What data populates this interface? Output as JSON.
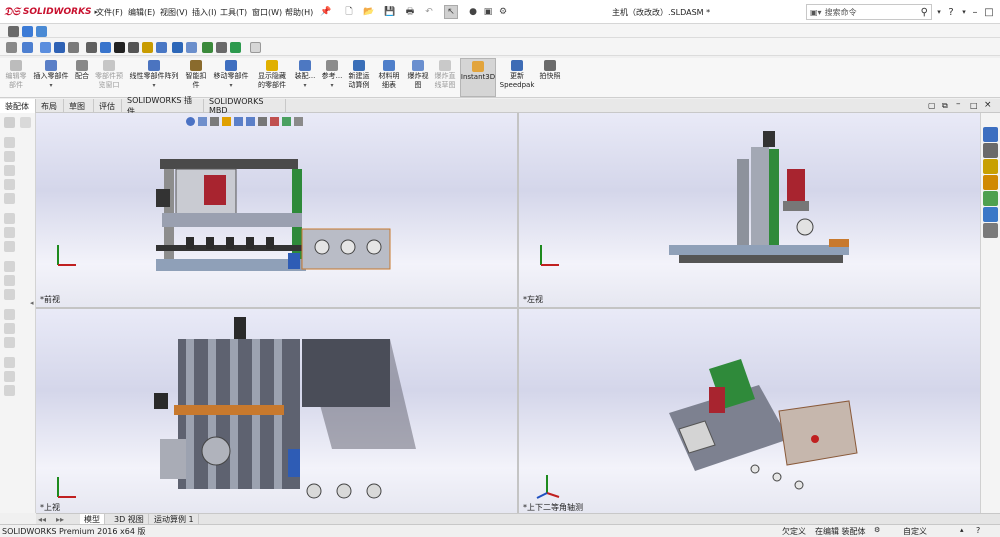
{
  "app": {
    "logo_text": "SOLIDWORKS",
    "document_title": "主机（改改改）.SLDASM *",
    "search_placeholder": "搜索命令"
  },
  "menu": [
    "文件(F)",
    "编辑(E)",
    "视图(V)",
    "插入(I)",
    "工具(T)",
    "窗口(W)",
    "帮助(H)"
  ],
  "commands": [
    {
      "label": "编辑零\n部件",
      "disabled": true
    },
    {
      "label": "插入零部件",
      "disabled": false
    },
    {
      "label": "配合",
      "disabled": false
    },
    {
      "label": "零部件预\n览窗口",
      "disabled": true
    },
    {
      "label": "线性零部件阵列",
      "disabled": false
    },
    {
      "label": "智能扣\n件",
      "disabled": false
    },
    {
      "label": "移动零部件",
      "disabled": false
    },
    {
      "label": "显示隐藏\n的零部件",
      "disabled": false
    },
    {
      "label": "装配...",
      "disabled": false
    },
    {
      "label": "参考...",
      "disabled": false
    },
    {
      "label": "新建运\n动算例",
      "disabled": false
    },
    {
      "label": "材料明\n细表",
      "disabled": false
    },
    {
      "label": "爆炸视\n图",
      "disabled": false
    },
    {
      "label": "爆炸直\n线草图",
      "disabled": true
    },
    {
      "label": "Instant3D",
      "disabled": false,
      "active": true
    },
    {
      "label": "更新\nSpeedpak",
      "disabled": false
    },
    {
      "label": "拍快照",
      "disabled": false
    }
  ],
  "tabs": [
    "装配体",
    "布局",
    "草图",
    "评估",
    "SOLIDWORKS 插件",
    "SOLIDWORKS MBD"
  ],
  "selected_tab": "装配体",
  "viewports": {
    "front": "*前视",
    "left": "*左视",
    "top": "*上视",
    "iso": "*上下二等角轴测"
  },
  "bottom_tabs": [
    "模型",
    "3D 视图",
    "运动算例 1"
  ],
  "status": {
    "product": "SOLIDWORKS Premium 2016 x64 版",
    "defined": "欠定义",
    "editing": "在编辑 装配体",
    "custom": "自定义",
    "help": "?"
  },
  "colors": {
    "accent_red": "#c8102e",
    "active_cmd": "#d5d5d5"
  }
}
